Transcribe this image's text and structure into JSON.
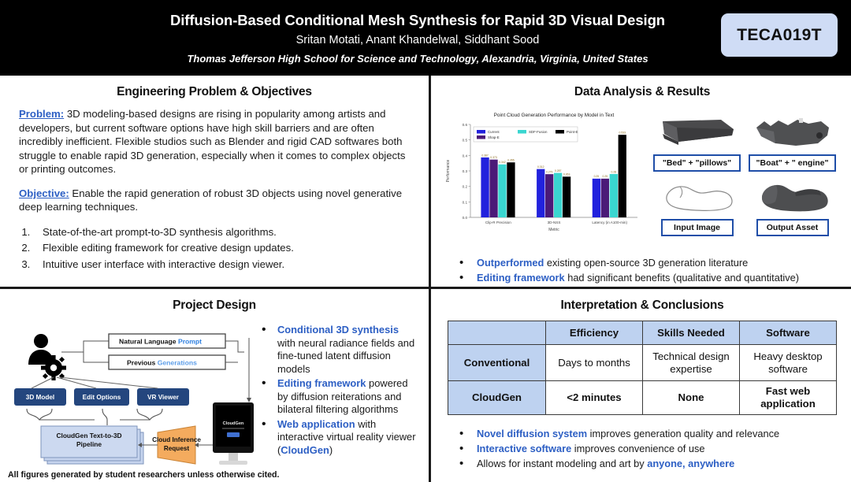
{
  "header": {
    "title": "Diffusion-Based Conditional Mesh Synthesis for Rapid 3D Visual Design",
    "authors": "Sritan Motati, Anant Khandelwal, Siddhant Sood",
    "affiliation": "Thomas Jefferson High School for Science and Technology, Alexandria, Virginia, United States",
    "badge": "TECA019T",
    "badge_color": "#cfdcf5",
    "bg_color": "#000000"
  },
  "panels": {
    "problem": {
      "title": "Engineering Problem & Objectives",
      "problem_label": "Problem:",
      "problem_text": " 3D modeling-based designs are rising in popularity among artists and developers, but current software options have high skill barriers and are often incredibly inefficient. Flexible studios such as Blender and rigid CAD softwares both struggle to enable rapid 3D generation, especially when it comes to complex objects or printing outcomes.",
      "objective_label": "Objective:",
      "objective_text": " Enable the rapid generation of robust 3D objects using novel generative deep learning techniques.",
      "objectives": [
        "State-of-the-art prompt-to-3D synthesis algorithms.",
        "Flexible editing framework for creative design updates.",
        "Intuitive user interface with interactive design viewer."
      ]
    },
    "results": {
      "title": "Data Analysis & Results",
      "captions": [
        "\"Bed\" + \"pillows\"",
        "\"Boat\" + \" engine\"",
        "Input Image",
        "Output Asset"
      ],
      "bullets": [
        {
          "bold": "Outperformed",
          "rest": " existing open-source 3D generation literature"
        },
        {
          "bold": "Editing framework",
          "rest": " had significant benefits (qualitative and quantitative)"
        }
      ]
    },
    "design": {
      "title": "Project Design",
      "diagram": {
        "prompt_box_a": "Natural Language ",
        "prompt_box_a_hl": "Prompt",
        "prompt_box_b": "Previous ",
        "prompt_box_b_hl": "Generations",
        "nodes": [
          "3D Model",
          "Edit Options",
          "VR Viewer"
        ],
        "pipeline": "CloudGen Text-to-3D Pipeline",
        "inference": "Cloud Inference Request",
        "screen_title": "CloudGen"
      },
      "bullets": [
        {
          "bold": "Conditional 3D synthesis",
          "rest": " with neural radiance fields and fine-tuned latent diffusion models"
        },
        {
          "bold": "Editing framework",
          "rest": " powered by diffusion reiterations and bilateral filtering algorithms"
        },
        {
          "bold": "Web application",
          "rest": " with interactive virtual reality viewer (",
          "bold2": "CloudGen",
          "rest2": ")"
        }
      ],
      "footnote": "All figures generated by student researchers unless otherwise cited."
    },
    "conclusions": {
      "title": "Interpretation & Conclusions",
      "table": {
        "columns": [
          "",
          "Efficiency",
          "Skills Needed",
          "Software"
        ],
        "rows": [
          {
            "label": "Conventional",
            "cells": [
              "Days to months",
              "Technical design expertise",
              "Heavy desktop software"
            ]
          },
          {
            "label": "CloudGen",
            "cells": [
              "<2 minutes",
              "None",
              "Fast web application"
            ]
          }
        ],
        "header_bg": "#bed2f0"
      },
      "bullets": [
        {
          "bold": "Novel diffusion system",
          "rest": " improves generation quality and relevance"
        },
        {
          "bold": "Interactive software",
          "rest": " improves convenience of use"
        },
        {
          "bold": "",
          "rest": "Allows for instant modeling and art by ",
          "bold2": "anyone, anywhere",
          "rest2": ""
        }
      ]
    }
  },
  "chart_data": {
    "type": "bar",
    "title": "Point Cloud Generation Performance by Model in Text",
    "xlabel": "Metric",
    "ylabel": "Performance",
    "ylim": [
      0.0,
      0.6
    ],
    "yticks": [
      0.0,
      0.1,
      0.2,
      0.3,
      0.4,
      0.5,
      0.6
    ],
    "categories": [
      "Clip-R Precision",
      "3D-NSS",
      "Latency (in A100-min)"
    ],
    "grid": false,
    "legend_position": "upper-left",
    "series": [
      {
        "name": "Current",
        "color": "#2222dd",
        "values": [
          0.387,
          0.312,
          0.25
        ],
        "labels": [
          "0.387",
          "0.312",
          "0.25"
        ]
      },
      {
        "name": "Shap-E",
        "color": "#4b1a78",
        "values": [
          0.373,
          0.279,
          0.25
        ],
        "labels": [
          "0.373",
          "0.279",
          "0.25"
        ]
      },
      {
        "name": "SDF-Fusion",
        "color": "#3ad6d0",
        "values": [
          0.342,
          0.287,
          0.28
        ],
        "labels": [
          "0.342",
          "0.287",
          "0.28"
        ]
      },
      {
        "name": "Point-E",
        "color": "#000000",
        "values": [
          0.355,
          0.263,
          0.533
        ],
        "labels": [
          "0.355",
          "0.263",
          "0.533"
        ]
      }
    ]
  }
}
